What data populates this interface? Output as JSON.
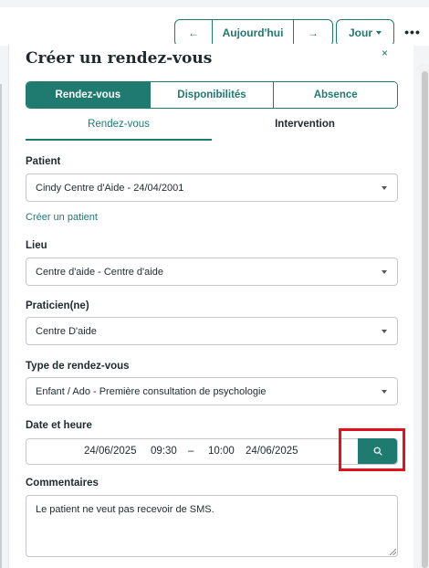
{
  "toolbar": {
    "prev_icon": "arrow-left-icon",
    "prev_glyph": "←",
    "today_label": "Aujourd'hui",
    "next_icon": "arrow-right-icon",
    "next_glyph": "→",
    "view_label": "Jour",
    "more_glyph": "•••"
  },
  "modal": {
    "title": "Créer un rendez-vous",
    "close_glyph": "×",
    "tabs": [
      {
        "label": "Rendez-vous",
        "active": true
      },
      {
        "label": "Disponibilités",
        "active": false
      },
      {
        "label": "Absence",
        "active": false
      }
    ],
    "subtabs": [
      {
        "label": "Rendez-vous",
        "active": true
      },
      {
        "label": "Intervention",
        "active": false
      }
    ],
    "patient": {
      "label": "Patient",
      "value": "Cindy Centre d'Aide - 24/04/2001"
    },
    "create_patient_link": "Créer un patient",
    "lieu": {
      "label": "Lieu",
      "value": "Centre d'aide - Centre d'aide"
    },
    "praticien": {
      "label": "Praticien(ne)",
      "value": "Centre D'aide"
    },
    "type": {
      "label": "Type de rendez-vous",
      "value": "Enfant / Ado - Première consultation de psychologie"
    },
    "datetime": {
      "label": "Date et heure",
      "start_date": "24/06/2025",
      "start_time": "09:30",
      "separator": "–",
      "end_time": "10:00",
      "end_date": "24/06/2025"
    },
    "comments": {
      "label": "Commentaires",
      "value": "Le patient ne veut pas recevoir de SMS."
    }
  },
  "colors": {
    "accent": "#1f7a70",
    "highlight": "#e3101b"
  }
}
